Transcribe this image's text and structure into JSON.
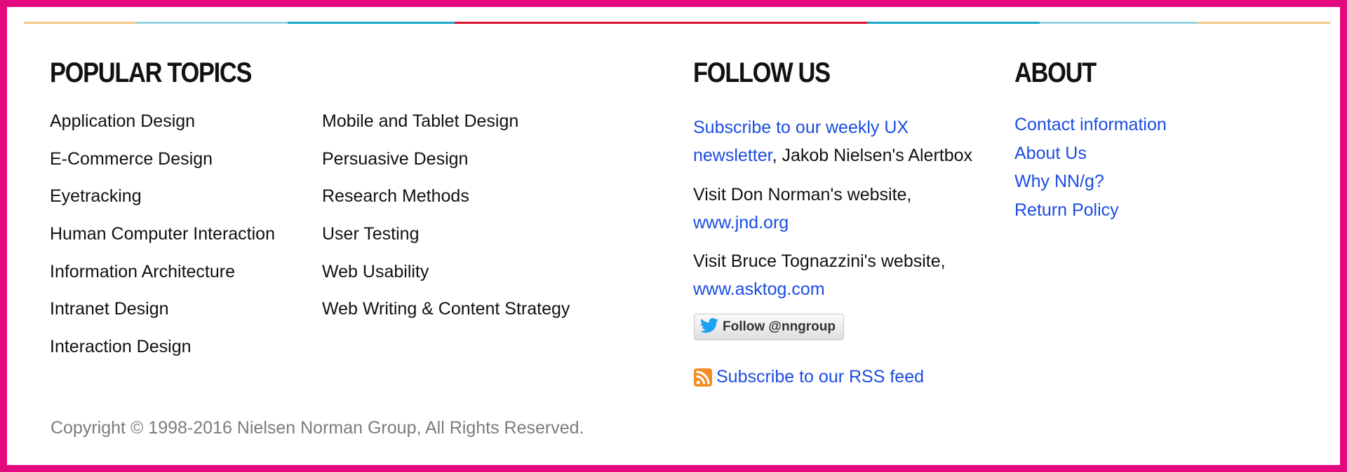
{
  "colors": {
    "border": "#e5097f",
    "link": "#1b4de0",
    "text": "#111111",
    "muted": "#7c7c7c",
    "stripe": [
      "#f5c98a",
      "#9ad3e0",
      "#1aa6c4",
      "#d8102d",
      "#1aa6c4",
      "#9ad3e0",
      "#f5c98a"
    ]
  },
  "popular_topics": {
    "heading": "POPULAR TOPICS",
    "column1": [
      "Application Design",
      "E-Commerce Design",
      "Eyetracking",
      "Human Computer Interaction",
      "Information Architecture",
      "Intranet Design",
      "Interaction Design"
    ],
    "column2": [
      "Mobile and Tablet Design",
      "Persuasive Design",
      "Research Methods",
      "User Testing",
      "Web Usability",
      "Web Writing & Content Strategy"
    ]
  },
  "follow_us": {
    "heading": "FOLLOW US",
    "newsletter_link": "Subscribe to our weekly UX newsletter",
    "newsletter_suffix": ", Jakob Nielsen's Alertbox",
    "norman_text": "Visit Don Norman's website,",
    "norman_link": "www.jnd.org",
    "tog_text": "Visit Bruce Tognazzini's website,",
    "tog_link": "www.asktog.com",
    "twitter_button": "Follow @nngroup",
    "twitter_icon": "twitter-bird-icon",
    "rss_icon": "rss-icon",
    "rss_link": "Subscribe to our RSS feed"
  },
  "about": {
    "heading": "ABOUT",
    "links": [
      "Contact information",
      "About Us",
      "Why NN/g?",
      "Return Policy"
    ]
  },
  "copyright": "Copyright © 1998-2016 Nielsen Norman Group, All Rights Reserved."
}
